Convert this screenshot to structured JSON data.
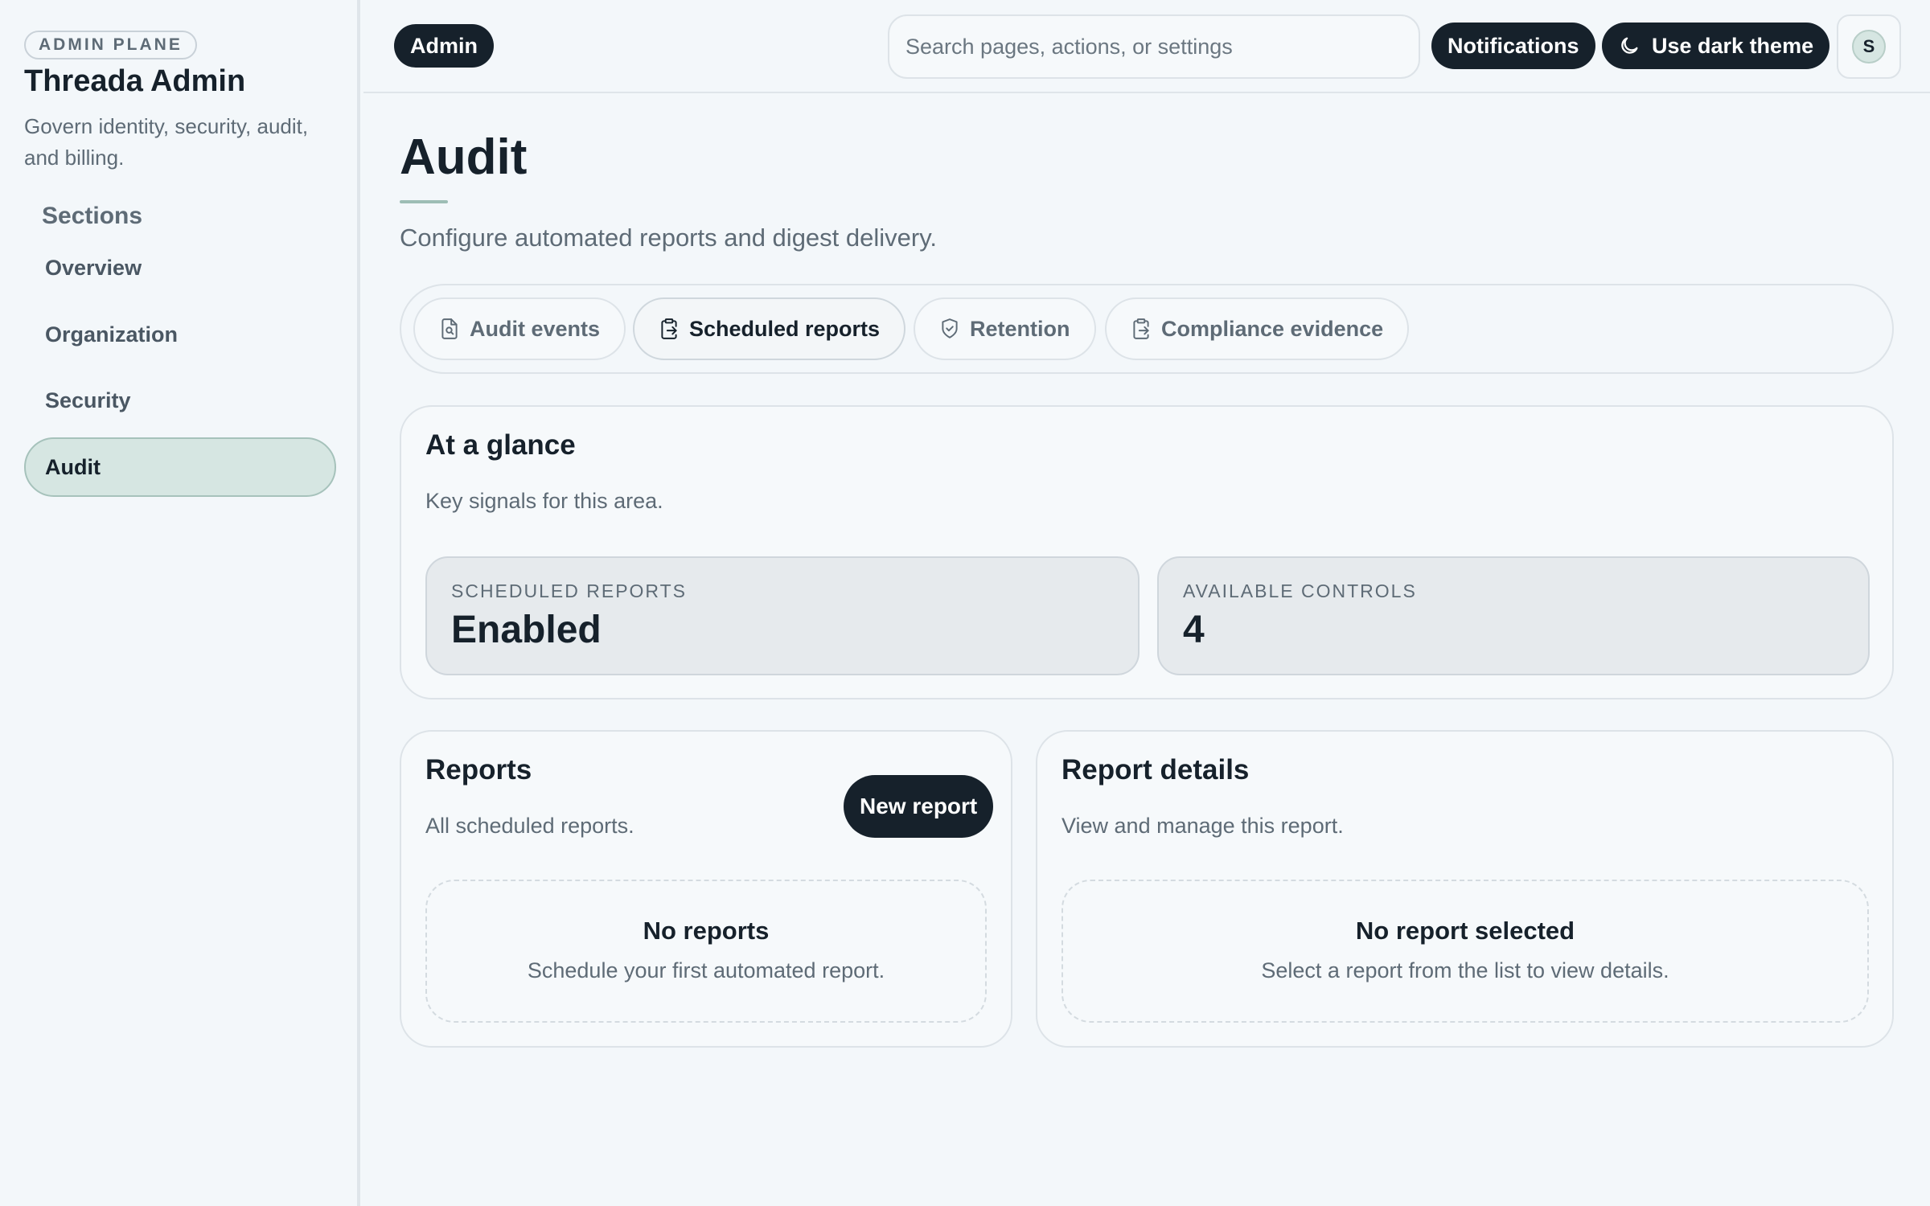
{
  "sidebar": {
    "badge": "ADMIN PLANE",
    "title": "Threada Admin",
    "description": "Govern identity, security, audit, and billing.",
    "sections_label": "Sections",
    "items": [
      {
        "label": "Overview",
        "active": false
      },
      {
        "label": "Organization",
        "active": false
      },
      {
        "label": "Security",
        "active": false
      },
      {
        "label": "Audit",
        "active": true
      }
    ]
  },
  "topbar": {
    "admin_pill": "Admin",
    "search_placeholder": "Search pages, actions, or settings",
    "notifications_label": "Notifications",
    "theme_label": "Use dark theme",
    "theme_icon": "moon-icon",
    "avatar_initial": "S"
  },
  "page": {
    "title": "Audit",
    "description": "Configure automated reports and digest delivery."
  },
  "tabs": [
    {
      "label": "Audit events",
      "icon": "document-search-icon",
      "active": false
    },
    {
      "label": "Scheduled reports",
      "icon": "clipboard-icon",
      "active": true
    },
    {
      "label": "Retention",
      "icon": "shield-icon",
      "active": false
    },
    {
      "label": "Compliance evidence",
      "icon": "clipboard-icon",
      "active": false
    }
  ],
  "glance": {
    "title": "At a glance",
    "description": "Key signals for this area.",
    "stats": [
      {
        "label": "SCHEDULED REPORTS",
        "value": "Enabled"
      },
      {
        "label": "AVAILABLE CONTROLS",
        "value": "4"
      }
    ]
  },
  "reports": {
    "title": "Reports",
    "description": "All scheduled reports.",
    "new_button": "New report",
    "empty_title": "No reports",
    "empty_desc": "Schedule your first automated report."
  },
  "details": {
    "title": "Report details",
    "description": "View and manage this report.",
    "empty_title": "No report selected",
    "empty_desc": "Select a report from the list to view details."
  },
  "colors": {
    "accent_dark": "#16212b",
    "active_nav_bg": "#d6e6e2",
    "muted_text": "#5e6b76",
    "background": "#f3f7fa"
  }
}
